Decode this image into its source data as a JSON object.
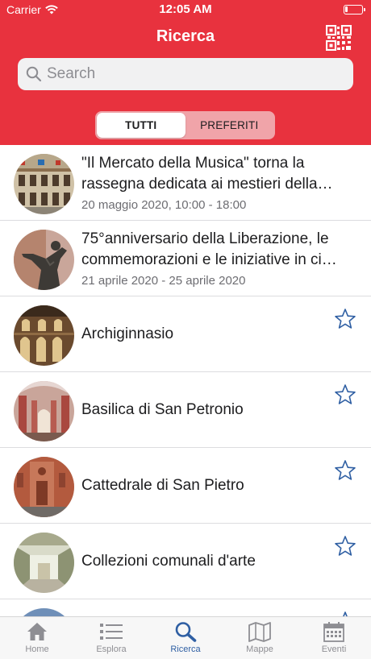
{
  "status_bar": {
    "carrier": "Carrier",
    "time": "12:05 AM",
    "battery_level": 0.15
  },
  "header": {
    "title": "Ricerca",
    "qr_icon": "qr-code-icon",
    "accent_color": "#e8323e"
  },
  "search": {
    "placeholder": "Search",
    "value": ""
  },
  "segmented": {
    "selected": "TUTTI",
    "options": [
      "TUTTI",
      "PREFERITI"
    ]
  },
  "list": {
    "items": [
      {
        "type": "event",
        "title": "\"Il Mercato della Musica\" torna la rassegna dedicata ai mestieri della…",
        "date": "20 maggio 2020, 10:00 - 18:00",
        "thumbnail": "building-facade-photo"
      },
      {
        "type": "event",
        "title": "75°anniversario della Liberazione, le commemorazioni e le iniziative in ci…",
        "date": "21 aprile 2020 - 25 aprile 2020",
        "thumbnail": "statue-photo"
      },
      {
        "type": "place",
        "title": "Archiginnasio",
        "favorite": false,
        "thumbnail": "arcade-photo"
      },
      {
        "type": "place",
        "title": "Basilica di San Petronio",
        "favorite": false,
        "thumbnail": "church-interior-photo"
      },
      {
        "type": "place",
        "title": "Cattedrale di San Pietro",
        "favorite": false,
        "thumbnail": "cathedral-facade-photo"
      },
      {
        "type": "place",
        "title": "Collezioni comunali d'arte",
        "favorite": false,
        "thumbnail": "gallery-hall-photo"
      }
    ]
  },
  "tabbar": {
    "active": "Ricerca",
    "active_color": "#2f5fa3",
    "tabs": [
      {
        "label": "Home",
        "icon": "home-icon"
      },
      {
        "label": "Esplora",
        "icon": "list-icon"
      },
      {
        "label": "Ricerca",
        "icon": "search-icon"
      },
      {
        "label": "Mappe",
        "icon": "map-icon"
      },
      {
        "label": "Eventi",
        "icon": "calendar-icon"
      }
    ]
  }
}
